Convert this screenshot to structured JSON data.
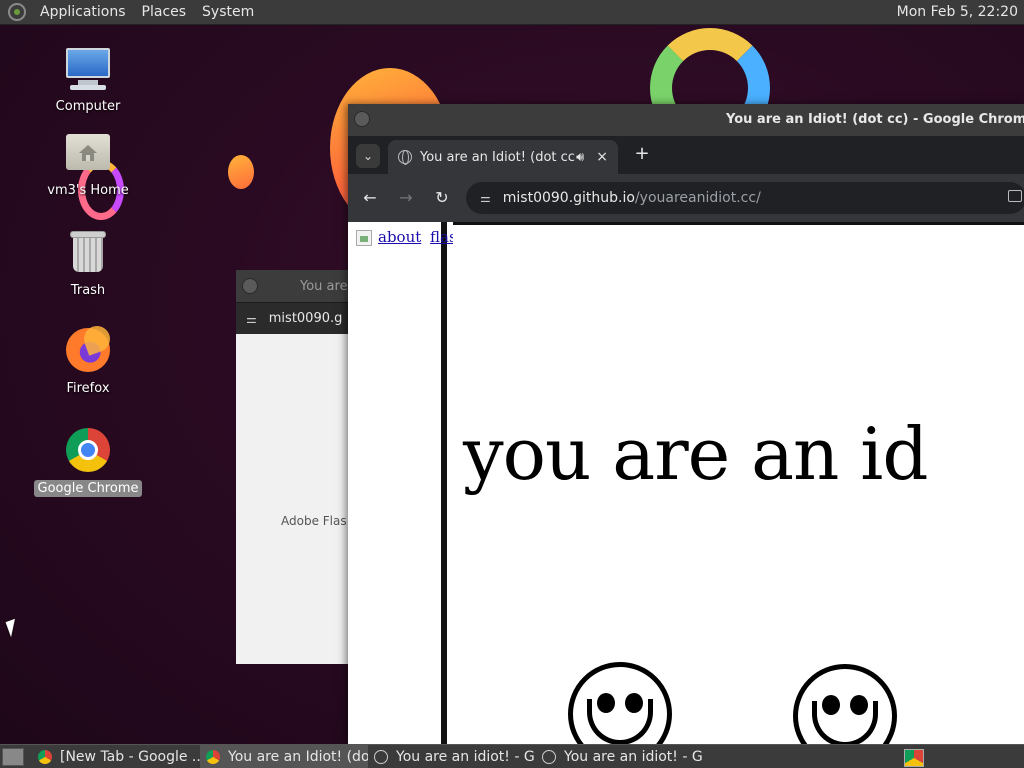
{
  "top_panel": {
    "menu_items": [
      "Applications",
      "Places",
      "System"
    ],
    "clock": "Mon Feb  5, 22:20"
  },
  "desktop_icons": [
    {
      "label": "Computer",
      "icon": "computer-icon"
    },
    {
      "label": "vm3's Home",
      "icon": "home-folder-icon"
    },
    {
      "label": "Trash",
      "icon": "trash-icon"
    },
    {
      "label": "Firefox",
      "icon": "firefox-icon"
    },
    {
      "label": "Google Chrome",
      "icon": "chrome-icon",
      "selected": true
    }
  ],
  "popup_window": {
    "title": "You are",
    "url": "mist0090.g",
    "body_text": "Adobe Flas"
  },
  "chrome_window": {
    "title": "You are an Idiot! (dot cc) - Google Chrome",
    "tab": {
      "title": "You are an Idiot! (dot cc)",
      "audio_icon": "speaker-icon",
      "close": "×"
    },
    "new_tab": "+",
    "address": {
      "host": "mist0090.github.io",
      "path": "/youareanidiot.cc/"
    },
    "page": {
      "links": [
        "about",
        "flash"
      ],
      "headline": "you are an id"
    }
  },
  "taskbar": {
    "buttons": [
      {
        "label": "[New Tab - Google ...",
        "icon": "chrome",
        "active": false
      },
      {
        "label": "You are an Idiot! (do...",
        "icon": "chrome",
        "active": true
      },
      {
        "label": "You are an idiot! - G...",
        "icon": "globe",
        "active": false
      },
      {
        "label": "You are an idiot! - G...",
        "icon": "globe",
        "active": false
      }
    ]
  },
  "colors": {
    "desktop_background": "#2a0a22",
    "panel": "#3b3b3b",
    "chrome_frame": "#3c3c3c",
    "link": "#1a0dab"
  }
}
